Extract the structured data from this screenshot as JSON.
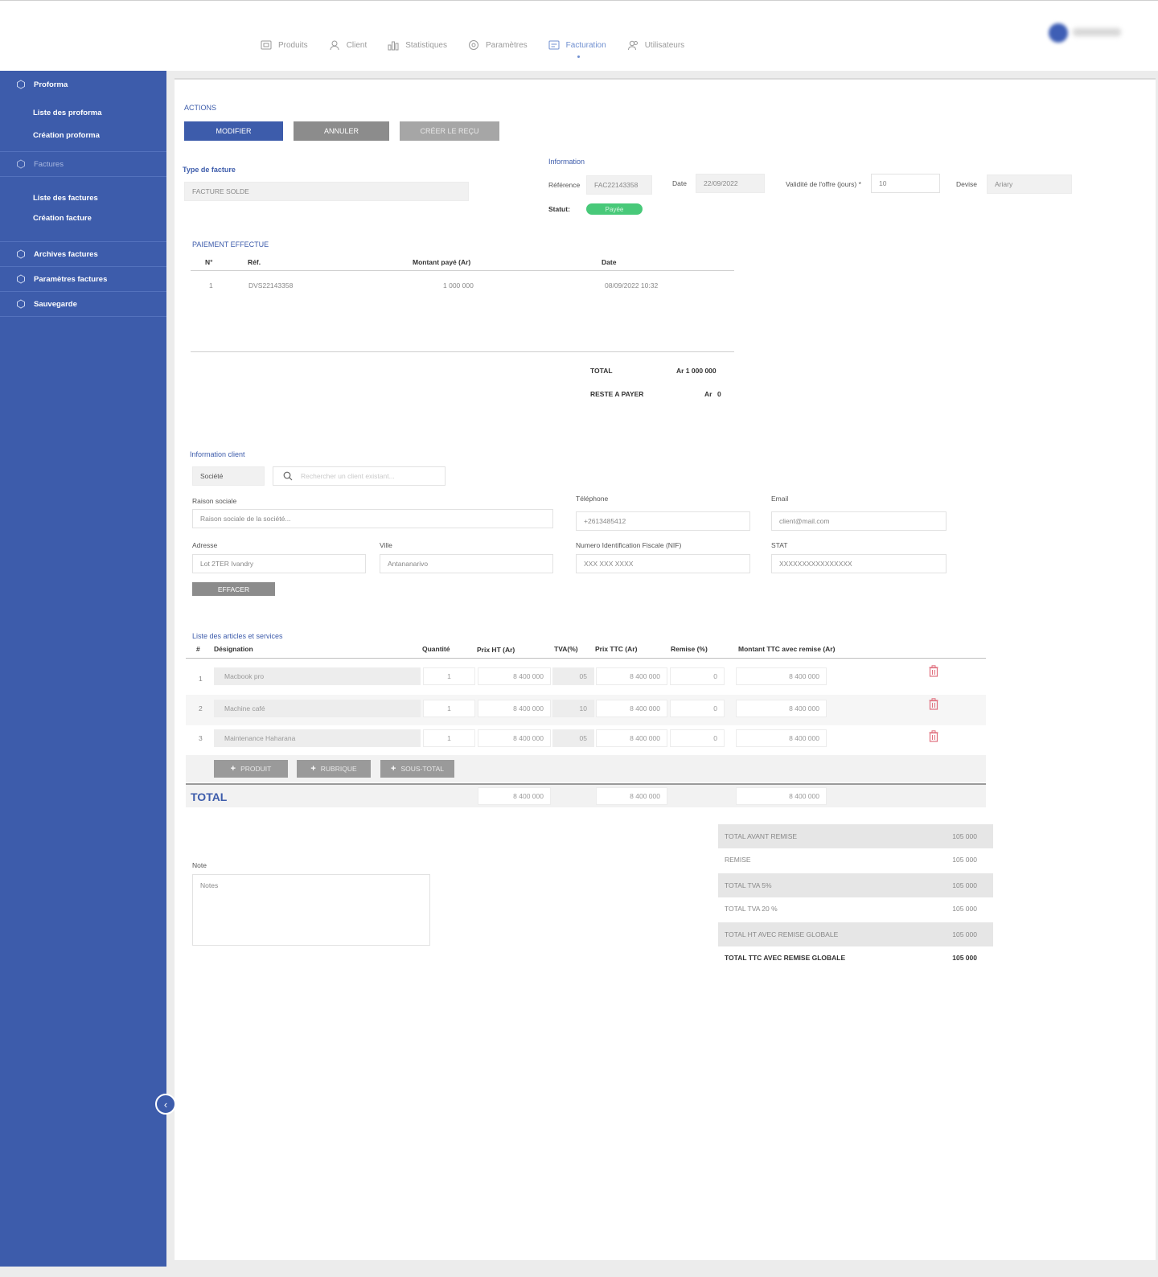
{
  "topnav": [
    {
      "label": "Produits",
      "icon": "products-icon"
    },
    {
      "label": "Client",
      "icon": "client-icon"
    },
    {
      "label": "Statistiques",
      "icon": "stats-icon"
    },
    {
      "label": "Paramètres",
      "icon": "settings-icon"
    },
    {
      "label": "Facturation",
      "icon": "billing-icon",
      "active": true
    },
    {
      "label": "Utilisateurs",
      "icon": "users-icon"
    }
  ],
  "sidebar": {
    "proforma": "Proforma",
    "proforma_items": [
      "Liste des proforma",
      "Création proforma"
    ],
    "factures": "Factures",
    "factures_items": [
      "Liste des factures",
      "Création facture"
    ],
    "archives": "Archives factures",
    "parametres": "Paramètres factures",
    "sauvegarde": "Sauvegarde",
    "collapse_glyph": "‹"
  },
  "actions": {
    "title": "ACTIONS",
    "modifier": "MODIFIER",
    "annuler": "ANNULER",
    "creer_recu": "CRÉER LE REÇU"
  },
  "type_facture": {
    "label": "Type de facture",
    "value": "FACTURE SOLDE"
  },
  "information": {
    "title": "Information",
    "reference_label": "Référence",
    "reference_value": "FAC22143358",
    "date_label": "Date",
    "date_value": "22/09/2022",
    "validite_label": "Validité de l'offre (jours) *",
    "validite_value": "10",
    "devise_label": "Devise",
    "devise_value": "Ariary",
    "statut_label": "Statut:",
    "statut_value": "Payée"
  },
  "paiement": {
    "title": "PAIEMENT EFFECTUE",
    "headers": [
      "N°",
      "Réf.",
      "Montant payé (Ar)",
      "Date"
    ],
    "rows": [
      {
        "n": "1",
        "ref": "DVS22143358",
        "montant": "1 000 000",
        "date": "08/09/2022 10:32"
      }
    ],
    "total_label": "TOTAL",
    "total_value": "Ar 1 000 000",
    "reste_label": "RESTE A PAYER",
    "reste_currency": "Ar",
    "reste_value": "0"
  },
  "client": {
    "title": "Information client",
    "type_value": "Société",
    "search_placeholder": "Rechercher un client existant...",
    "raison_label": "Raison sociale",
    "raison_placeholder": "Raison sociale de la société...",
    "tel_label": "Téléphone",
    "tel_value": "+2613485412",
    "email_label": "Email",
    "email_value": "client@mail.com",
    "adresse_label": "Adresse",
    "adresse_value": "Lot 2TER Ivandry",
    "ville_label": "Ville",
    "ville_value": "Antananarivo",
    "nif_label": "Numero Identification Fiscale (NIF)",
    "nif_value": "XXX XXX XXXX",
    "stat_label": "STAT",
    "stat_value": "XXXXXXXXXXXXXXXX",
    "effacer": "EFFACER"
  },
  "articles": {
    "title": "Liste des articles et services",
    "headers": {
      "num": "#",
      "designation": "Désignation",
      "quantite": "Quantité",
      "prix_ht": "Prix HT (Ar)",
      "tva": "TVA(%)",
      "prix_ttc": "Prix TTC (Ar)",
      "remise": "Remise (%)",
      "montant": "Montant TTC avec remise (Ar)"
    },
    "rows": [
      {
        "n": "1",
        "designation": "Macbook pro",
        "quantite": "1",
        "prix_ht": "8 400 000",
        "tva": "05",
        "prix_ttc": "8 400 000",
        "remise": "0",
        "montant": "8 400 000"
      },
      {
        "n": "2",
        "designation": "Machine café",
        "quantite": "1",
        "prix_ht": "8 400 000",
        "tva": "10",
        "prix_ttc": "8 400 000",
        "remise": "0",
        "montant": "8 400 000"
      },
      {
        "n": "3",
        "designation": "Maintenance Haharana",
        "quantite": "1",
        "prix_ht": "8 400 000",
        "tva": "05",
        "prix_ttc": "8 400 000",
        "remise": "0",
        "montant": "8 400 000"
      }
    ],
    "add_produit": "PRODUIT",
    "add_rubrique": "RUBRIQUE",
    "add_sous_total": "SOUS-TOTAL",
    "total_label": "TOTAL",
    "total_ht": "8 400 000",
    "total_ttc": "8 400 000",
    "total_montant": "8 400 000"
  },
  "note": {
    "label": "Note",
    "placeholder": "Notes"
  },
  "summary": [
    {
      "label": "TOTAL AVANT REMISE",
      "value": "105 000"
    },
    {
      "label": "REMISE",
      "value": "105 000"
    },
    {
      "label": "TOTAL TVA 5%",
      "value": "105 000"
    },
    {
      "label": "TOTAL TVA 20 %",
      "value": "105 000"
    },
    {
      "label": "TOTAL HT AVEC REMISE GLOBALE",
      "value": "105 000"
    },
    {
      "label": "TOTAL TTC AVEC REMISE GLOBALE",
      "value": "105 000"
    }
  ],
  "colors": {
    "primary": "#3d5cab",
    "status_green": "#48c979",
    "trash_red": "#e0707f"
  }
}
